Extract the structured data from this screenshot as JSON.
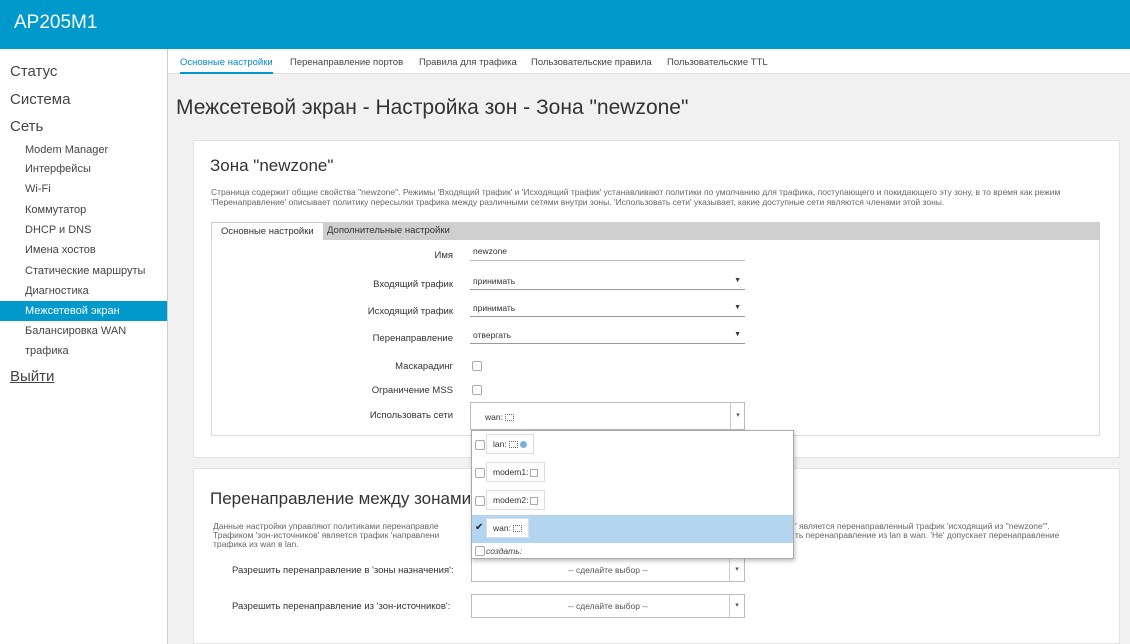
{
  "app": {
    "title": "AP205M1"
  },
  "sidebar": {
    "top": [
      "Статус",
      "Система",
      "Сеть"
    ],
    "items": [
      {
        "label": "Modem Manager",
        "active": false
      },
      {
        "label": "Интерфейсы",
        "active": false
      },
      {
        "label": "Wi-Fi",
        "active": false
      },
      {
        "label": "Коммутатор",
        "active": false
      },
      {
        "label": "DHCP и DNS",
        "active": false
      },
      {
        "label": "Имена хостов",
        "active": false
      },
      {
        "label": "Статические маршруты",
        "active": false
      },
      {
        "label": "Диагностика",
        "active": false
      },
      {
        "label": "Межсетевой экран",
        "active": true
      },
      {
        "label": "Балансировка WAN трафика",
        "active": false
      }
    ],
    "logout": "Выйти"
  },
  "tabs": [
    {
      "label": "Основные настройки",
      "active": true
    },
    {
      "label": "Перенаправление портов",
      "active": false
    },
    {
      "label": "Правила для трафика",
      "active": false
    },
    {
      "label": "Пользовательские правила",
      "active": false
    },
    {
      "label": "Пользовательские TTL",
      "active": false
    }
  ],
  "page_title": "Межсетевой экран - Настройка зон - Зона \"newzone\"",
  "zone_section": {
    "title": "Зона \"newzone\"",
    "description": "Страница содержит общие свойства \"newzone\". Режимы 'Входящий трафик' и 'Исходящий трафик' устанавливают политики по умолчанию для трафика, поступающего и покидающего эту зону, в то время как режим 'Перенаправление' описывает политику пересылки трафика между различными сетями внутри зоны. 'Использовать сети' указывает, какие доступные сети являются членами этой зоны.",
    "subtabs": [
      {
        "label": "Основные настройки",
        "active": true
      },
      {
        "label": "Дополнительные настройки",
        "active": false
      }
    ],
    "fields": {
      "name": {
        "label": "Имя",
        "value": "newzone"
      },
      "input": {
        "label": "Входящий трафик",
        "value": "принимать"
      },
      "output": {
        "label": "Исходящий трафик",
        "value": "принимать"
      },
      "forward": {
        "label": "Перенаправление",
        "value": "отвергать"
      },
      "masquerading": {
        "label": "Маскарадинг",
        "checked": false
      },
      "mss_clamping": {
        "label": "Ограничение MSS",
        "checked": false
      },
      "networks": {
        "label": "Использовать сети",
        "value": "wan:"
      }
    }
  },
  "network_dropdown": {
    "options": [
      {
        "label": "lan:",
        "checked": false
      },
      {
        "label": "modem1:",
        "checked": false
      },
      {
        "label": "modem2:",
        "checked": false
      },
      {
        "label": "wan:",
        "checked": true
      }
    ],
    "create": "создать:"
  },
  "forwarding_section": {
    "title": "Перенаправление между зонами",
    "desc_left": "Данные настройки управляют политиками перенаправле",
    "desc_right": "' является перенаправленный трафик 'исходящий из \"newzone\"'.",
    "desc_line2_left": "Трафиком 'зон-источников' является трафик 'направлени",
    "desc_line2_right": "ть перенаправление из lan в wan. 'Не' допускает перенаправление",
    "desc_line3": "трафика из wan в lan.",
    "allow_to": {
      "label": "Разрешить перенаправление в 'зоны назначения':",
      "value": "-- сделайте выбор --"
    },
    "allow_from": {
      "label": "Разрешить перенаправление из 'зон-источников':",
      "value": "-- сделайте выбор --"
    }
  },
  "colors": {
    "accent": "#0099cc",
    "selected_row": "#b4d5f0"
  }
}
